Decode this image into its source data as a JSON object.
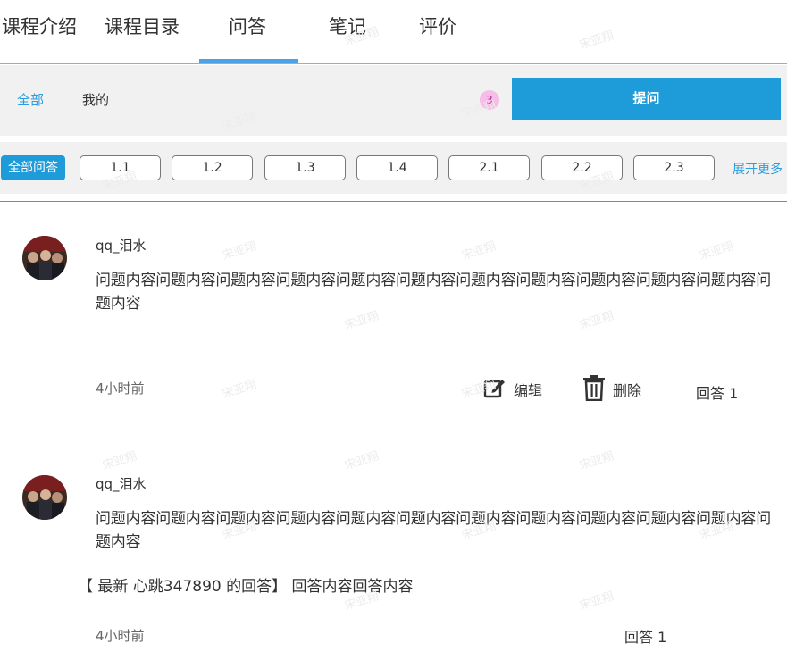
{
  "tabs": [
    {
      "label": "课程介绍"
    },
    {
      "label": "课程目录"
    },
    {
      "label": "问答"
    },
    {
      "label": "笔记"
    },
    {
      "label": "评价"
    }
  ],
  "subnav": {
    "all_label": "全部",
    "mine_label": "我的",
    "badge_count": "3",
    "ask_button": "提问"
  },
  "filters": {
    "all_label": "全部问答",
    "chapters": [
      "1.1",
      "1.2",
      "1.3",
      "1.4",
      "2.1",
      "2.2",
      "2.3"
    ],
    "expand_label": "展开更多"
  },
  "questions": [
    {
      "user": "qq_泪水",
      "content": "问题内容问题内容问题内容问题内容问题内容问题内容问题内容问题内容问题内容问题内容问题内容问题内容",
      "time": "4小时前",
      "edit_label": "编辑",
      "delete_label": "删除",
      "reply_count": "回答 1"
    },
    {
      "user": "qq_泪水",
      "content": "问题内容问题内容问题内容问题内容问题内容问题内容问题内容问题内容问题内容问题内容问题内容问题内容",
      "latest_answer": "【 最新 心跳347890 的回答】 回答内容回答内容",
      "time": "4小时前",
      "reply_count": "回答 1"
    }
  ],
  "watermark": "宋亚翔",
  "colors": {
    "accent": "#1e9bd9",
    "link": "#2b9de0",
    "badge_bg": "#f6bde6",
    "tab_underline": "#4aa3e6"
  }
}
